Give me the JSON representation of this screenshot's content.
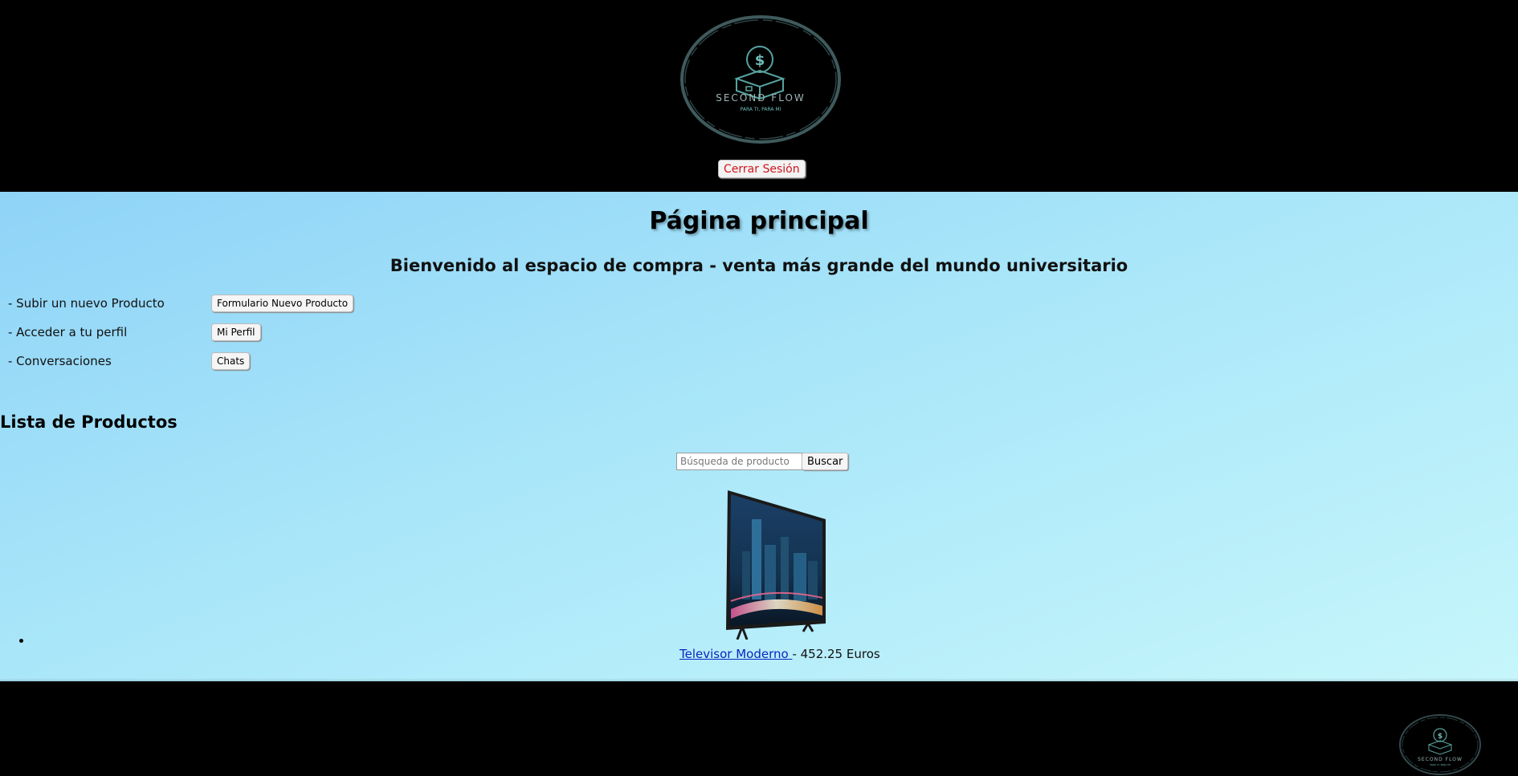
{
  "header": {
    "logo": {
      "brand": "SECOND FLOW",
      "tagline": "PARA TI, PARA MI",
      "symbol": "$"
    },
    "logout_label": "Cerrar Sesión",
    "logout_color": "#d2151b"
  },
  "main": {
    "title": "Página principal",
    "welcome": "Bienvenido al espacio de compra - venta más grande del mundo universitario",
    "menu": [
      {
        "label": "- Subir un nuevo Producto",
        "button": "Formulario Nuevo Producto"
      },
      {
        "label": "- Acceder a tu perfil",
        "button": "Mi Perfil"
      },
      {
        "label": "- Conversaciones",
        "button": "Chats"
      }
    ],
    "list_title": "Lista de Productos",
    "search": {
      "placeholder": "Búsqueda de producto",
      "button": "Buscar"
    },
    "products": [
      {
        "name": "Televisor Moderno ",
        "price_text": " - 452.25 Euros"
      }
    ]
  },
  "footer": {
    "logo": {
      "brand": "SECOND FLOW",
      "tagline": "PARA TI, PARA MI",
      "symbol": "$"
    }
  },
  "colors": {
    "header_bg": "#000000",
    "main_gradient_start": "#8fd3f7",
    "main_gradient_end": "#c6f6fb",
    "logo_accent": "#4f8c8c",
    "link": "#0b26c0"
  }
}
